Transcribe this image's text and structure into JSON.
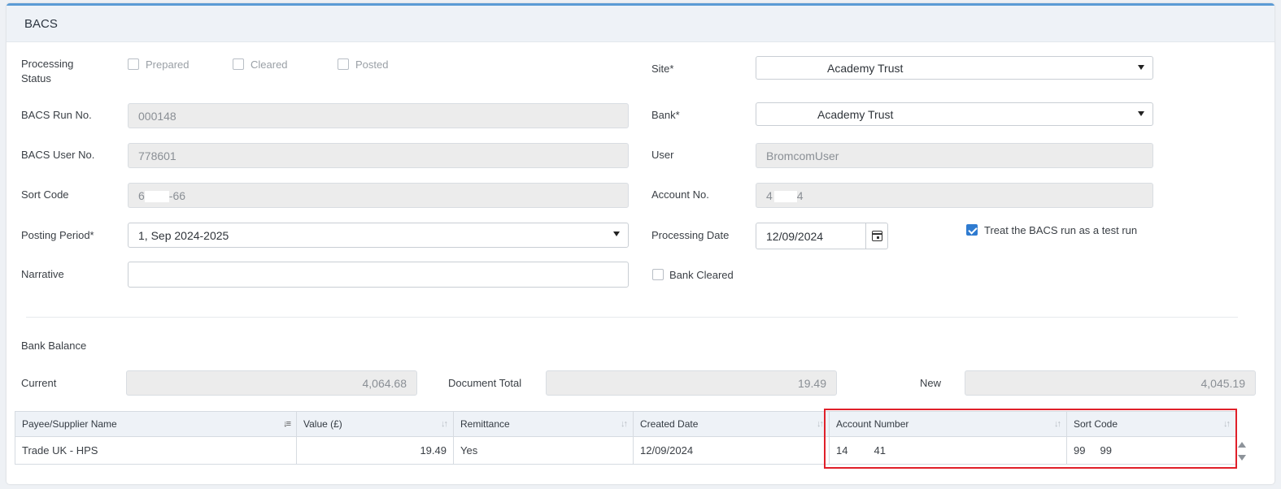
{
  "panel": {
    "title": "BACS"
  },
  "form": {
    "processing_status_label": "Processing Status",
    "status_options": [
      "Prepared",
      "Cleared",
      "Posted"
    ],
    "bacs_run_label": "BACS Run No.",
    "bacs_run_value": "000148",
    "bacs_user_label": "BACS User No.",
    "bacs_user_value": "778601",
    "sort_code_label": "Sort Code",
    "sort_code_prefix": "6",
    "sort_code_suffix": "-66",
    "posting_period_label": "Posting Period*",
    "posting_period_value": "1, Sep 2024-2025",
    "narrative_label": "Narrative",
    "narrative_value": "",
    "site_label": "Site*",
    "site_value": "Academy Trust",
    "bank_label": "Bank*",
    "bank_value": "Academy Trust",
    "user_label": "User",
    "user_value": "BromcomUser",
    "account_no_label": "Account No.",
    "account_no_prefix": "4",
    "account_no_suffix": "4",
    "processing_date_label": "Processing Date",
    "processing_date_value": "12/09/2024",
    "test_run_label": "Treat the BACS run as a test run",
    "test_run_checked": true,
    "bank_cleared_label": "Bank Cleared",
    "bank_cleared_checked": false
  },
  "balance": {
    "section_label": "Bank Balance",
    "current_label": "Current",
    "current_value": "4,064.68",
    "document_total_label": "Document Total",
    "document_total_value": "19.49",
    "new_label": "New",
    "new_value": "4,045.19"
  },
  "table": {
    "columns": [
      "Payee/Supplier Name",
      "Value (£)",
      "Remittance",
      "Created Date",
      "Account Number",
      "Sort Code"
    ],
    "rows": [
      {
        "payee": "Trade UK - HPS",
        "value": "19.49",
        "remittance": "Yes",
        "created_date": "12/09/2024",
        "account_number_a": "14",
        "account_number_b": "41",
        "sort_code_a": "99",
        "sort_code_b": "99"
      }
    ]
  },
  "colors": {
    "accent": "#5b9bd5",
    "highlight": "#e0202a",
    "checkbox": "#2f7bd0"
  }
}
